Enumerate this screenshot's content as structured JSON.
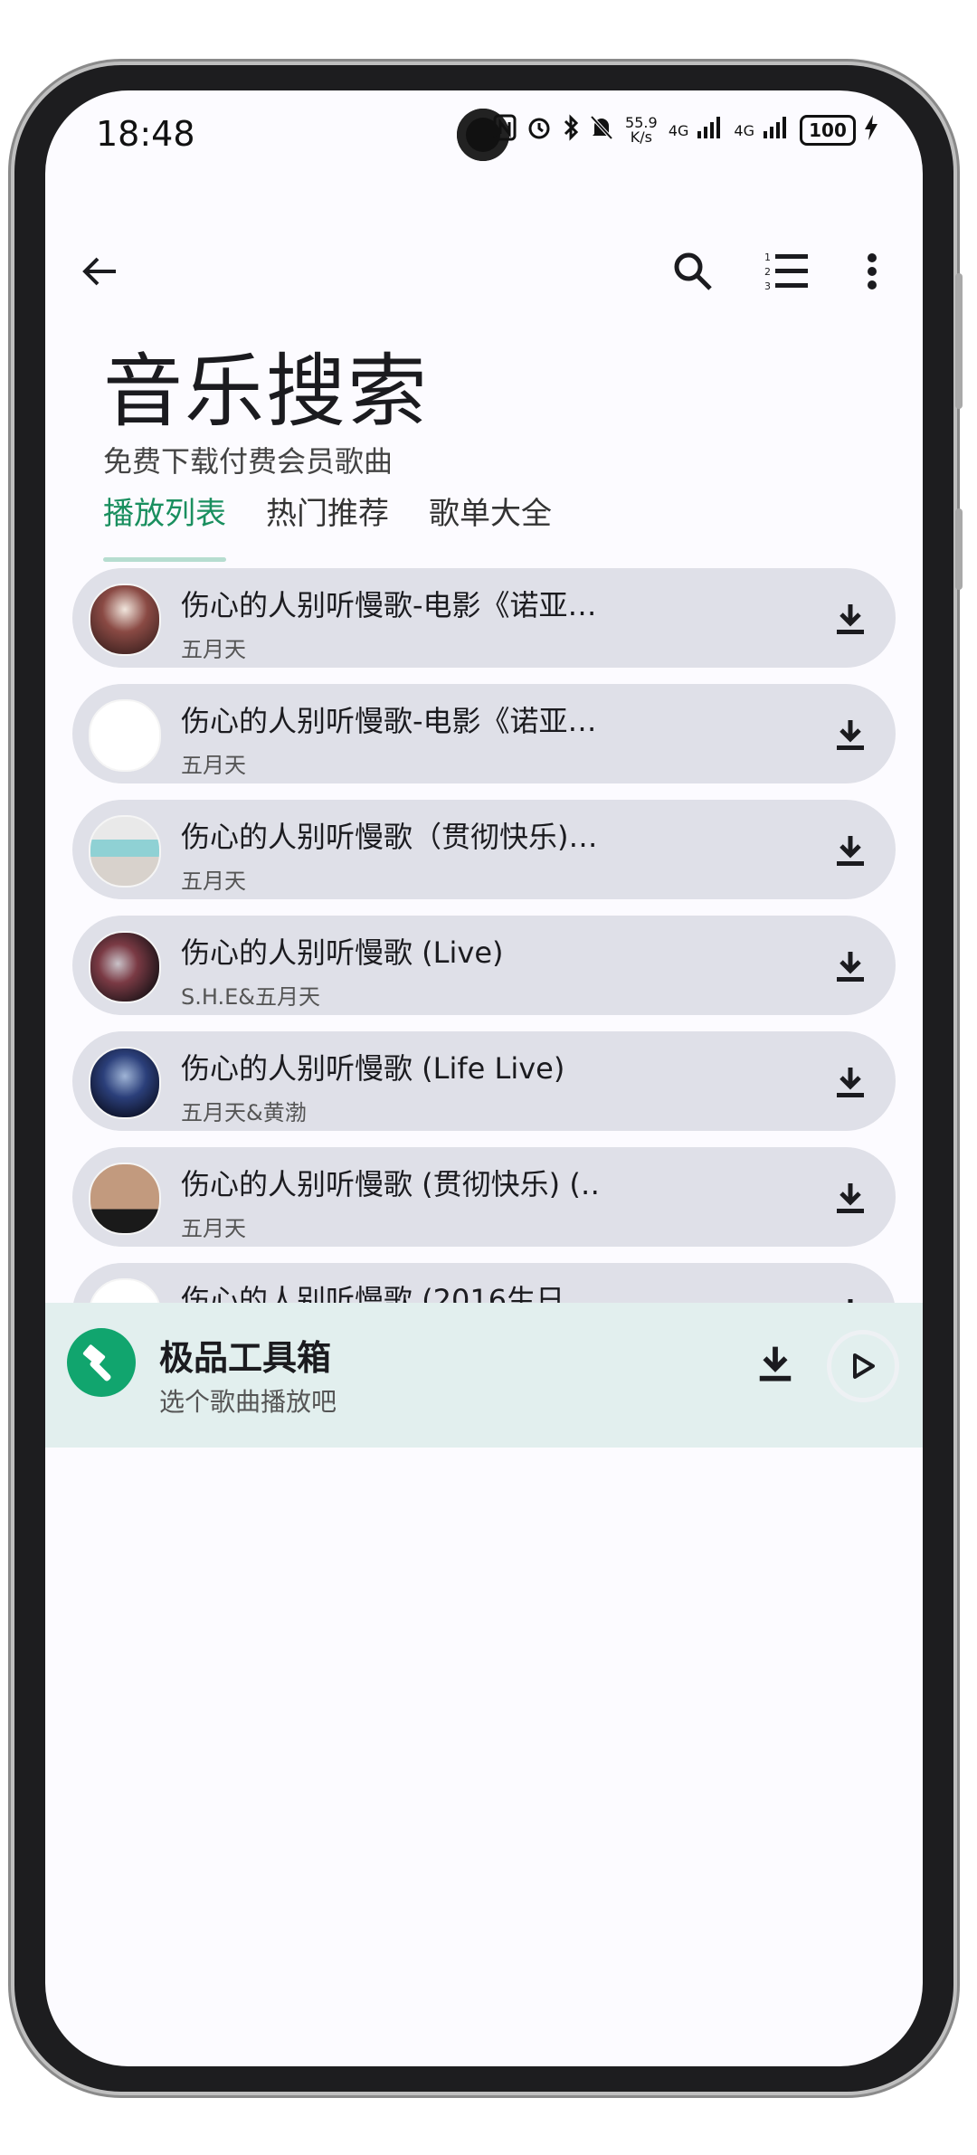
{
  "status_bar": {
    "time": "18:48",
    "net_speed": "55.9 K/s",
    "sim1": "4G",
    "sim2": "4G",
    "battery": "100"
  },
  "appbar": {
    "back_icon": "arrow-back-icon",
    "search_icon": "search-icon",
    "list_icon": "numbered-list-icon",
    "more_icon": "more-vert-icon"
  },
  "header": {
    "title": "音乐搜索",
    "subtitle": "免费下载付费会员歌曲"
  },
  "tabs": [
    {
      "label": "播放列表",
      "active": true
    },
    {
      "label": "热门推荐",
      "active": false
    },
    {
      "label": "歌单大全",
      "active": false
    }
  ],
  "songs": [
    {
      "title": "伤心的人别听慢歌-电影《诺亚…",
      "artist": "五月天",
      "cover": "dark-red"
    },
    {
      "title": "伤心的人别听慢歌-电影《诺亚…",
      "artist": "五月天",
      "cover": "blank"
    },
    {
      "title": "伤心的人别听慢歌（贯彻快乐)…",
      "artist": "五月天",
      "cover": "collage"
    },
    {
      "title": "伤心的人别听慢歌 (Live)",
      "artist": "S.H.E&五月天",
      "cover": "stage"
    },
    {
      "title": "伤心的人别听慢歌 (Life Live)",
      "artist": "五月天&黄渤",
      "cover": "blue"
    },
    {
      "title": "伤心的人别听慢歌 (贯彻快乐) (…",
      "artist": "五月天",
      "cover": "faces"
    },
    {
      "title": "伤心的人别听慢歌 (2016生日…",
      "artist": "",
      "cover": "blank"
    }
  ],
  "player": {
    "title": "极品工具箱",
    "subtitle": "选个歌曲播放吧",
    "logo_icon": "hammer-icon",
    "accent": "#11a56e"
  },
  "colors": {
    "tab_active": "#1a8f5f",
    "card_bg": "#dfe0e8",
    "player_bg": "#e2efee"
  }
}
